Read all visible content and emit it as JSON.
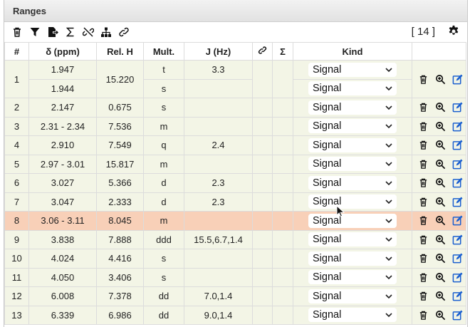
{
  "panel": {
    "title": "Ranges"
  },
  "toolbar": {
    "count": "[ 14 ]",
    "icons": [
      "trash-icon",
      "filter-icon",
      "export-icon",
      "sum-icon",
      "unlink-icon",
      "hierarchy-icon",
      "link-icon"
    ]
  },
  "columns": [
    "#",
    "δ (ppm)",
    "Rel. H",
    "Mult.",
    "J (Hz)",
    "",
    "Σ",
    "Kind",
    ""
  ],
  "rows": [
    {
      "num": "1",
      "shift": "1.947",
      "relh": "15.220",
      "mult": "t",
      "j": "3.3",
      "kind": "Signal",
      "sub": {
        "shift": "1.944",
        "mult": "s",
        "j": "",
        "kind": "Signal"
      }
    },
    {
      "num": "2",
      "shift": "2.147",
      "relh": "0.675",
      "mult": "s",
      "j": "",
      "kind": "Signal"
    },
    {
      "num": "3",
      "shift": "2.31 - 2.34",
      "relh": "7.536",
      "mult": "m",
      "j": "",
      "kind": "Signal"
    },
    {
      "num": "4",
      "shift": "2.910",
      "relh": "7.549",
      "mult": "q",
      "j": "2.4",
      "kind": "Signal"
    },
    {
      "num": "5",
      "shift": "2.97 - 3.01",
      "relh": "15.817",
      "mult": "m",
      "j": "",
      "kind": "Signal"
    },
    {
      "num": "6",
      "shift": "3.027",
      "relh": "5.366",
      "mult": "d",
      "j": "2.3",
      "kind": "Signal"
    },
    {
      "num": "7",
      "shift": "3.047",
      "relh": "2.333",
      "mult": "d",
      "j": "2.3",
      "kind": "Signal"
    },
    {
      "num": "8",
      "shift": "3.06 - 3.11",
      "relh": "8.045",
      "mult": "m",
      "j": "",
      "kind": "Signal",
      "selected": true
    },
    {
      "num": "9",
      "shift": "3.838",
      "relh": "7.888",
      "mult": "ddd",
      "j": "15.5,6.7,1.4",
      "kind": "Signal"
    },
    {
      "num": "10",
      "shift": "4.024",
      "relh": "4.416",
      "mult": "s",
      "j": "",
      "kind": "Signal"
    },
    {
      "num": "11",
      "shift": "4.050",
      "relh": "3.406",
      "mult": "s",
      "j": "",
      "kind": "Signal"
    },
    {
      "num": "12",
      "shift": "6.008",
      "relh": "7.378",
      "mult": "dd",
      "j": "7.0,1.4",
      "kind": "Signal"
    },
    {
      "num": "13",
      "shift": "6.339",
      "relh": "6.986",
      "mult": "dd",
      "j": "9.0,1.4",
      "kind": "Signal"
    }
  ],
  "colors": {
    "row_bg": "#f3f5e6",
    "selected_bg": "#f8d0b8",
    "edit_icon": "#1a5fd0"
  }
}
